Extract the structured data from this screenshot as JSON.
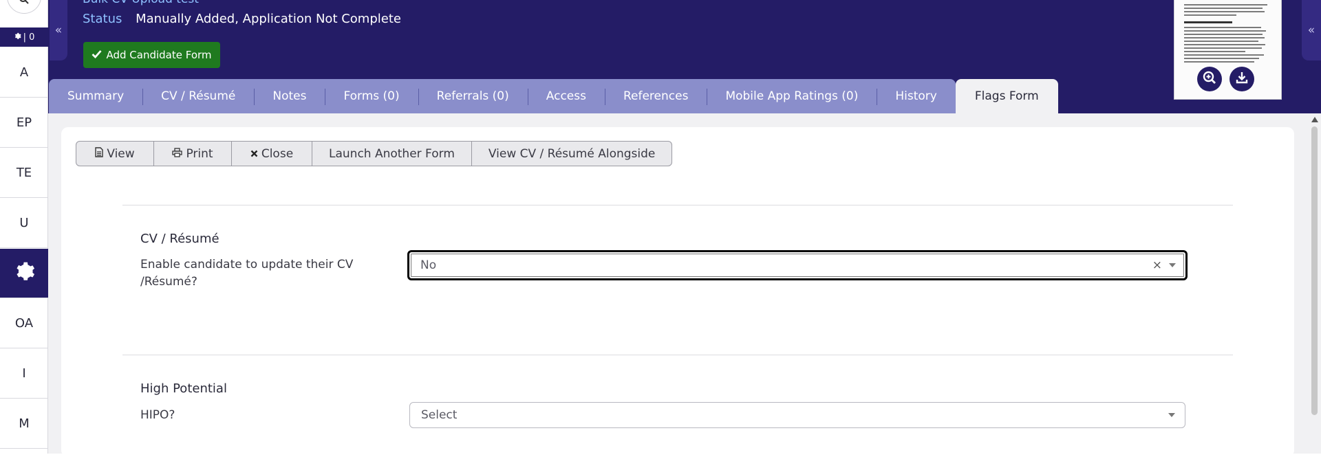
{
  "rail": {
    "counter": "| 0",
    "items": [
      {
        "label": "A"
      },
      {
        "label": "EP"
      },
      {
        "label": "TE"
      },
      {
        "label": "U"
      },
      {
        "label": ""
      },
      {
        "label": "OA"
      },
      {
        "label": "I"
      },
      {
        "label": "M"
      }
    ]
  },
  "header": {
    "candidate_name": "Bulk CV Upload test",
    "status_label": "Status",
    "status_value": "Manually Added, Application Not Complete",
    "add_form_button": "Add Candidate Form",
    "collapse_left": "«",
    "collapse_right": "«"
  },
  "tabs": [
    {
      "label": "Summary"
    },
    {
      "label": "CV / Résumé"
    },
    {
      "label": "Notes"
    },
    {
      "label": "Forms (0)"
    },
    {
      "label": "Referrals (0)"
    },
    {
      "label": "Access"
    },
    {
      "label": "References"
    },
    {
      "label": "Mobile App Ratings (0)"
    },
    {
      "label": "History"
    },
    {
      "label": "Flags Form"
    }
  ],
  "toolbar": {
    "view": "View",
    "print": "Print",
    "close": "Close",
    "launch": "Launch Another Form",
    "view_cv": "View CV / Résumé Alongside"
  },
  "form": {
    "sections": [
      {
        "title": "CV / Résumé",
        "field_label_line1": "Enable candidate to update their CV",
        "field_label_line2": "/Résumé?",
        "value": "No",
        "clear": "×"
      },
      {
        "title": "High Potential",
        "field_label": "HIPO?",
        "placeholder": "Select"
      }
    ]
  },
  "colors": {
    "header_bg": "#241c66",
    "tab_bar": "#8a8ecb",
    "add_button": "#1f7a1f",
    "link_blue": "#8fc1ff"
  }
}
